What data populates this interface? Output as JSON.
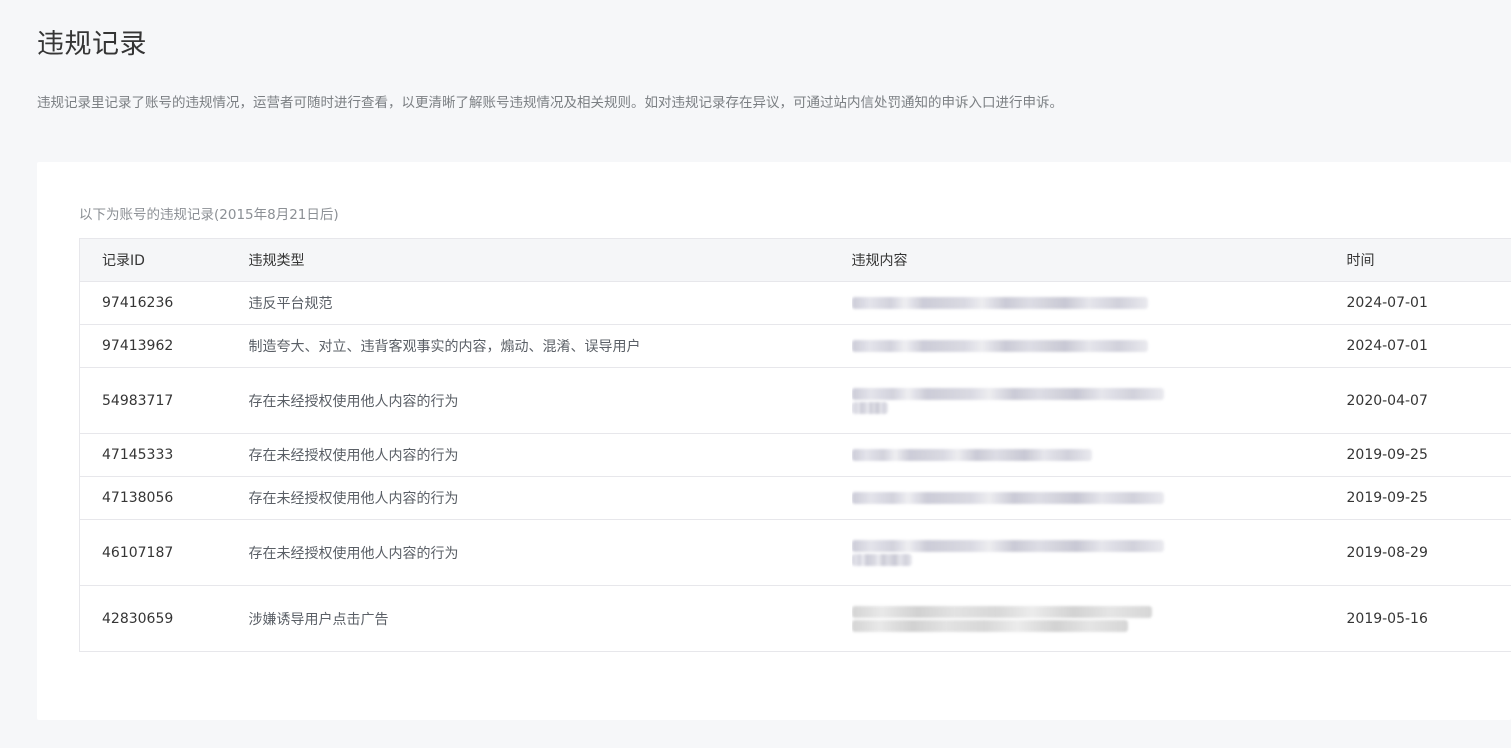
{
  "page": {
    "title": "违规记录",
    "description": "违规记录里记录了账号的违规情况，运营者可随时进行查看，以更清晰了解账号违规情况及相关规则。如对违规记录存在异议，可通过站内信处罚通知的申诉入口进行申诉。"
  },
  "table": {
    "caption": "以下为账号的违规记录(2015年8月21日后)",
    "headers": {
      "id": "记录ID",
      "type": "违规类型",
      "content": "违规内容",
      "time": "时间"
    },
    "rows": [
      {
        "id": "97416236",
        "type": "违反平台规范",
        "time": "2024-07-01"
      },
      {
        "id": "97413962",
        "type": "制造夸大、对立、违背客观事实的内容，煽动、混淆、误导用户",
        "time": "2024-07-01"
      },
      {
        "id": "54983717",
        "type": "存在未经授权使用他人内容的行为",
        "time": "2020-04-07"
      },
      {
        "id": "47145333",
        "type": "存在未经授权使用他人内容的行为",
        "time": "2019-09-25"
      },
      {
        "id": "47138056",
        "type": "存在未经授权使用他人内容的行为",
        "time": "2019-09-25"
      },
      {
        "id": "46107187",
        "type": "存在未经授权使用他人内容的行为",
        "time": "2019-08-29"
      },
      {
        "id": "42830659",
        "type": "涉嫌诱导用户点击广告",
        "time": "2019-05-16"
      }
    ]
  }
}
